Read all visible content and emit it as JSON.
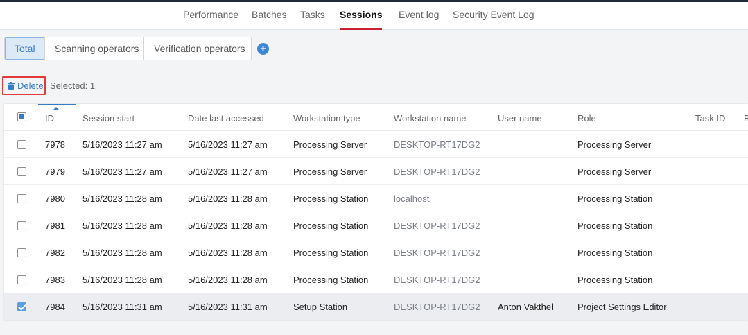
{
  "tabs": [
    "Performance",
    "Batches",
    "Tasks",
    "Sessions",
    "Event log",
    "Security Event Log"
  ],
  "active_tab": "Sessions",
  "filters": [
    "Total",
    "Scanning operators",
    "Verification operators"
  ],
  "active_filter": "Total",
  "add_symbol": "+",
  "toolbar": {
    "delete_label": "Delete",
    "selected_label": "Selected: 1"
  },
  "columns": [
    "ID",
    "Session start",
    "Date last accessed",
    "Workstation type",
    "Workstation name",
    "User name",
    "Role",
    "Task ID",
    "B"
  ],
  "rows": [
    {
      "checked": false,
      "id": "7978",
      "start": "5/16/2023 11:27 am",
      "accessed": "5/16/2023 11:27 am",
      "type": "Processing Server",
      "name": "DESKTOP-RT17DG2",
      "user": "",
      "role": "Processing Server",
      "task": ""
    },
    {
      "checked": false,
      "id": "7979",
      "start": "5/16/2023 11:27 am",
      "accessed": "5/16/2023 11:27 am",
      "type": "Processing Server",
      "name": "DESKTOP-RT17DG2",
      "user": "",
      "role": "Processing Server",
      "task": ""
    },
    {
      "checked": false,
      "id": "7980",
      "start": "5/16/2023 11:28 am",
      "accessed": "5/16/2023 11:28 am",
      "type": "Processing Station",
      "name": "localhost",
      "user": "",
      "role": "Processing Station",
      "task": ""
    },
    {
      "checked": false,
      "id": "7981",
      "start": "5/16/2023 11:28 am",
      "accessed": "5/16/2023 11:28 am",
      "type": "Processing Station",
      "name": "DESKTOP-RT17DG2",
      "user": "",
      "role": "Processing Station",
      "task": ""
    },
    {
      "checked": false,
      "id": "7982",
      "start": "5/16/2023 11:28 am",
      "accessed": "5/16/2023 11:28 am",
      "type": "Processing Station",
      "name": "DESKTOP-RT17DG2",
      "user": "",
      "role": "Processing Station",
      "task": ""
    },
    {
      "checked": false,
      "id": "7983",
      "start": "5/16/2023 11:28 am",
      "accessed": "5/16/2023 11:28 am",
      "type": "Processing Station",
      "name": "DESKTOP-RT17DG2",
      "user": "",
      "role": "Processing Station",
      "task": ""
    },
    {
      "checked": true,
      "id": "7984",
      "start": "5/16/2023 11:31 am",
      "accessed": "5/16/2023 11:31 am",
      "type": "Setup Station",
      "name": "DESKTOP-RT17DG2",
      "user": "Anton Vakthel",
      "role": "Project Settings Editor",
      "task": ""
    }
  ],
  "colors": {
    "accent": "#3a7bc8",
    "active_tab_underline": "#c8202f",
    "highlight_border": "#e23a3a"
  },
  "icons": {
    "delete": "trash-icon",
    "add": "plus-circle-icon",
    "sort": "sort-ascending-icon"
  }
}
